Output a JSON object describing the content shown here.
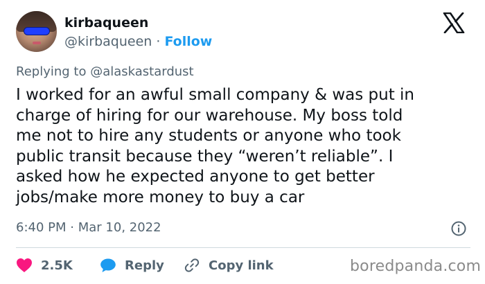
{
  "author": {
    "name": "kirbaqueen",
    "handle": "@kirbaqueen",
    "separator": "·",
    "follow_label": "Follow"
  },
  "reply_to": {
    "prefix": "Replying to",
    "handle": "@alaskastardust"
  },
  "tweet": {
    "lines": [
      "I worked for an awful small company & was put in",
      "charge of hiring for our warehouse. My boss told",
      "me not to hire any students or anyone who took",
      "public transit because they “weren’t reliable”. I",
      "asked how he expected anyone to get better",
      "jobs/make more money to buy a car"
    ]
  },
  "meta": {
    "time": "6:40 PM",
    "separator": "·",
    "date": "Mar 10, 2022"
  },
  "actions": {
    "likes": "2.5K",
    "reply_label": "Reply",
    "copy_label": "Copy link"
  },
  "watermark": "boredpanda.com",
  "icons": {
    "brand": "x-logo-icon",
    "info": "info-icon",
    "like": "heart-icon",
    "reply": "speech-bubble-icon",
    "copy": "link-icon"
  },
  "colors": {
    "text": "#0f1419",
    "secondary": "#536471",
    "accent": "#1d9bf0",
    "like": "#f91880",
    "divider": "#cfd9de"
  }
}
